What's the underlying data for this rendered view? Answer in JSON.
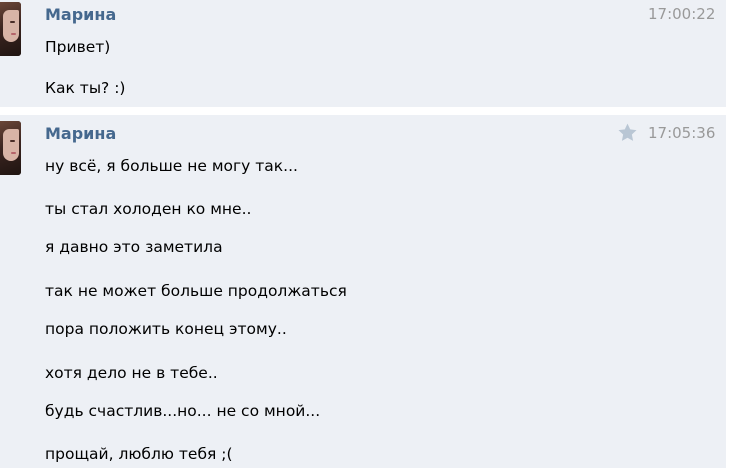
{
  "colors": {
    "group_background": "#edf0f5",
    "author": "#45688e",
    "time": "#999999",
    "star": "#b9c6d4"
  },
  "messages": [
    {
      "author": "Марина",
      "time": "17:00:22",
      "starred": false,
      "lines": [
        "Привет)",
        "Как ты? :)"
      ]
    },
    {
      "author": "Марина",
      "time": "17:05:36",
      "starred": true,
      "lines": [
        "ну всё, я больше не могу так...",
        "ты стал холоден ко мне..",
        "я давно это заметила",
        "так не может больше продолжаться",
        "пора положить конец этому..",
        "хотя дело не в тебе..",
        "будь счастлив...но... не со мной...",
        "прощай, люблю тебя ;("
      ]
    }
  ]
}
